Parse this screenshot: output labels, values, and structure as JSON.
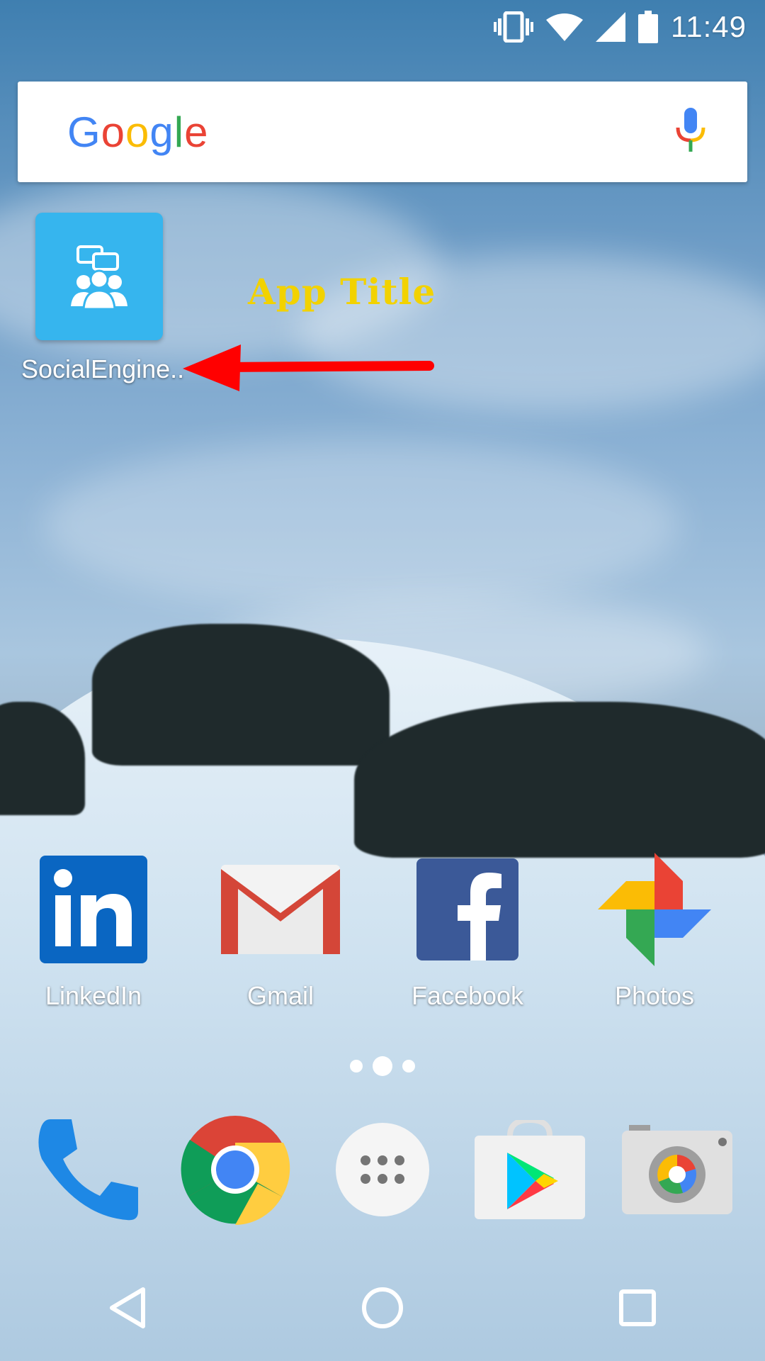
{
  "status_bar": {
    "time": "11:49",
    "icons": [
      "vibrate-icon",
      "wifi-icon",
      "cell-signal-icon",
      "battery-icon"
    ]
  },
  "search": {
    "logo_text": "Google",
    "mic_icon": "mic-icon"
  },
  "shortcut": {
    "label": "SocialEngine..",
    "icon": "social-group-chat-icon",
    "tile_color": "#36b5ee"
  },
  "annotation": {
    "title": "App  Title",
    "title_color": "#f2d200",
    "arrow_color": "#ff0000"
  },
  "home_apps": [
    {
      "label": "LinkedIn",
      "icon": "linkedin-icon"
    },
    {
      "label": "Gmail",
      "icon": "gmail-icon"
    },
    {
      "label": "Facebook",
      "icon": "facebook-icon"
    },
    {
      "label": "Photos",
      "icon": "photos-icon"
    }
  ],
  "pages": {
    "count": 3,
    "current": 2
  },
  "dock": [
    "phone-icon",
    "chrome-icon",
    "app-drawer-icon",
    "play-store-icon",
    "camera-icon"
  ],
  "nav": [
    "back-icon",
    "home-icon",
    "recents-icon"
  ]
}
